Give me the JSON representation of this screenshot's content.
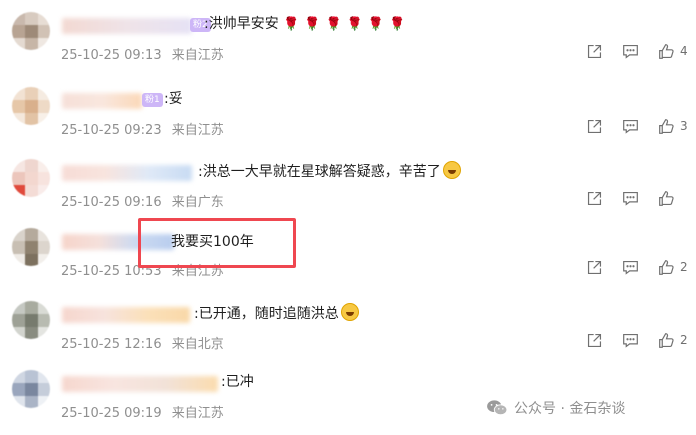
{
  "comments": [
    {
      "text": ":洪帅早安安",
      "roses": "🌹🌹🌹🌹🌹🌹",
      "fan_badge": "粉2",
      "date": "25-10-25 09:13",
      "location": "来自江苏",
      "likes": "4"
    },
    {
      "text": ":妥",
      "fan_badge": "粉1",
      "date": "25-10-25 09:23",
      "location": "来自江苏",
      "likes": "3"
    },
    {
      "text": ":洪总一大早就在星球解答疑惑，辛苦了",
      "date": "25-10-25 09:16",
      "location": "来自广东",
      "likes": ""
    },
    {
      "text": "我要买100年",
      "date": "25-10-25 10:53",
      "location": "来自江苏",
      "likes": "2"
    },
    {
      "text": ":已开通，随时追随洪总",
      "date": "25-10-25 12:16",
      "location": "来自北京",
      "likes": "2"
    },
    {
      "text": ":已冲",
      "date": "25-10-25 09:19",
      "location": "来自江苏",
      "likes": ""
    }
  ],
  "watermark": {
    "text": "公众号 · 金石杂谈"
  },
  "colors": {
    "highlight": "#ef4750",
    "meta_text": "#8f8f8f",
    "rose": "#d61f26"
  }
}
